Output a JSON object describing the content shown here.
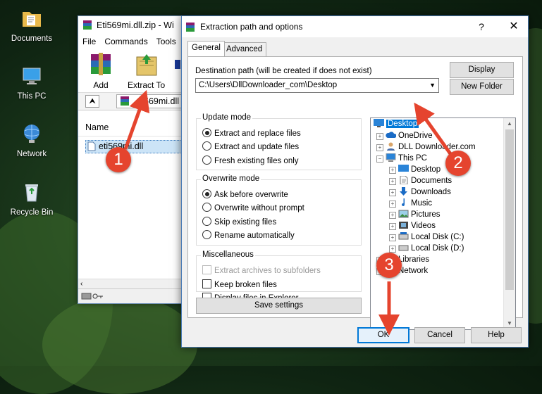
{
  "desktop": {
    "icons": [
      {
        "label": "Documents",
        "icon": "folder-documents-icon"
      },
      {
        "label": "This PC",
        "icon": "computer-icon"
      },
      {
        "label": "Network",
        "icon": "network-globe-icon"
      },
      {
        "label": "Recycle Bin",
        "icon": "recycle-bin-icon"
      }
    ]
  },
  "winrar": {
    "title": "Eti569mi.dll.zip - Wi",
    "menu": [
      "File",
      "Commands",
      "Tools"
    ],
    "toolbar": {
      "add": "Add",
      "extract_to": "Extract To"
    },
    "path_value": "569mi.dll",
    "column_name": "Name",
    "file": "eti569mi.dll"
  },
  "dialog": {
    "title": "Extraction path and options",
    "help_glyph": "?",
    "close_glyph": "✕",
    "tabs": [
      "General",
      "Advanced"
    ],
    "destination_label": "Destination path (will be created if does not exist)",
    "destination_value": "C:\\Users\\DllDownloader_com\\Desktop",
    "display_button": "Display",
    "new_folder_button": "New Folder",
    "update_mode": {
      "title": "Update mode",
      "options": [
        "Extract and replace files",
        "Extract and update files",
        "Fresh existing files only"
      ],
      "selected": 0
    },
    "overwrite_mode": {
      "title": "Overwrite mode",
      "options": [
        "Ask before overwrite",
        "Overwrite without prompt",
        "Skip existing files",
        "Rename automatically"
      ],
      "selected": 0
    },
    "misc": {
      "title": "Miscellaneous",
      "options": [
        "Extract archives to subfolders",
        "Keep broken files",
        "Display files in Explorer"
      ]
    },
    "save_settings": "Save settings",
    "tree": [
      {
        "label": "Desktop",
        "icon": "desktop-icon",
        "selected": true
      },
      {
        "label": "OneDrive",
        "icon": "onedrive-cloud-icon"
      },
      {
        "label": "DLL Downloader.com",
        "icon": "user-icon"
      },
      {
        "label": "This PC",
        "icon": "computer-icon"
      },
      {
        "label": "Desktop",
        "icon": "desktop-icon"
      },
      {
        "label": "Documents",
        "icon": "documents-icon"
      },
      {
        "label": "Downloads",
        "icon": "download-arrow-icon"
      },
      {
        "label": "Music",
        "icon": "music-note-icon"
      },
      {
        "label": "Pictures",
        "icon": "pictures-icon"
      },
      {
        "label": "Videos",
        "icon": "videos-icon"
      },
      {
        "label": "Local Disk (C:)",
        "icon": "disk-drive-icon"
      },
      {
        "label": "Local Disk (D:)",
        "icon": "disk-drive-icon"
      },
      {
        "label": "Libraries",
        "icon": "libraries-folder-icon"
      },
      {
        "label": "Network",
        "icon": "network-icon"
      }
    ],
    "ok": "OK",
    "cancel": "Cancel",
    "help": "Help"
  },
  "annotations": [
    "1",
    "2",
    "3"
  ],
  "colors": {
    "annotation": "#e5442e",
    "selection": "#0078d7",
    "ok_border": "#0078d7"
  }
}
